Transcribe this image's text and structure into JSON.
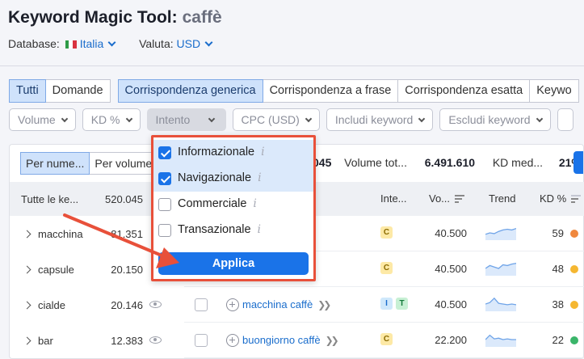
{
  "header": {
    "title": "Keyword Magic Tool:",
    "keyword": "caffè",
    "database_label": "Database:",
    "database_value": "Italia",
    "currency_label": "Valuta:",
    "currency_value": "USD"
  },
  "tabs": [
    "Tutti",
    "Domande",
    "Corrispondenza generica",
    "Corrispondenza a frase",
    "Corrispondenza esatta",
    "Keywo"
  ],
  "filters": [
    "Volume",
    "KD %",
    "Intento",
    "CPC (USD)",
    "Includi keyword",
    "Escludi keyword"
  ],
  "segment": [
    "Per nume...",
    "Per volume"
  ],
  "stats": {
    "count_value": "045",
    "volume_label": "Volume tot...",
    "volume_value": "6.491.610",
    "kd_label": "KD med...",
    "kd_value": "21%"
  },
  "sidebar": {
    "header_label": "Tutte le ke...",
    "header_count": "520.045",
    "items": [
      {
        "label": "macchina",
        "count": "81.351"
      },
      {
        "label": "capsule",
        "count": "20.150"
      },
      {
        "label": "cialde",
        "count": "20.146"
      },
      {
        "label": "bar",
        "count": "12.383"
      }
    ]
  },
  "table": {
    "headers": {
      "intent": "Inte...",
      "volume": "Vo...",
      "trend": "Trend",
      "kd": "KD %"
    },
    "rows": [
      {
        "keyword": "",
        "intents": [
          "C"
        ],
        "volume": "40.500",
        "kd": "59",
        "kd_color": "#f0883e",
        "trend": [
          0.4,
          0.5,
          0.45,
          0.6,
          0.7,
          0.75,
          0.7,
          0.8
        ]
      },
      {
        "keyword": "",
        "intents": [
          "C"
        ],
        "volume": "40.500",
        "kd": "48",
        "kd_color": "#f5b731",
        "trend": [
          0.5,
          0.7,
          0.6,
          0.5,
          0.75,
          0.7,
          0.8,
          0.85
        ]
      },
      {
        "keyword": "macchina caffè",
        "intents": [
          "I",
          "T"
        ],
        "volume": "40.500",
        "kd": "38",
        "kd_color": "#f5b731",
        "trend": [
          0.5,
          0.6,
          0.9,
          0.55,
          0.5,
          0.45,
          0.5,
          0.45
        ]
      },
      {
        "keyword": "buongiorno caffè",
        "intents": [
          "C"
        ],
        "volume": "22.200",
        "kd": "22",
        "kd_color": "#3ab56a",
        "trend": [
          0.5,
          0.8,
          0.55,
          0.6,
          0.5,
          0.55,
          0.5,
          0.5
        ]
      }
    ]
  },
  "dropdown": {
    "items": [
      {
        "label": "Informazionale",
        "checked": true
      },
      {
        "label": "Navigazionale",
        "checked": true
      },
      {
        "label": "Commerciale",
        "checked": false
      },
      {
        "label": "Transazionale",
        "checked": false
      }
    ],
    "apply_label": "Applica",
    "info_glyph": "i"
  },
  "colors": {
    "accent": "#1a73e8",
    "annotation": "#e8503a"
  }
}
